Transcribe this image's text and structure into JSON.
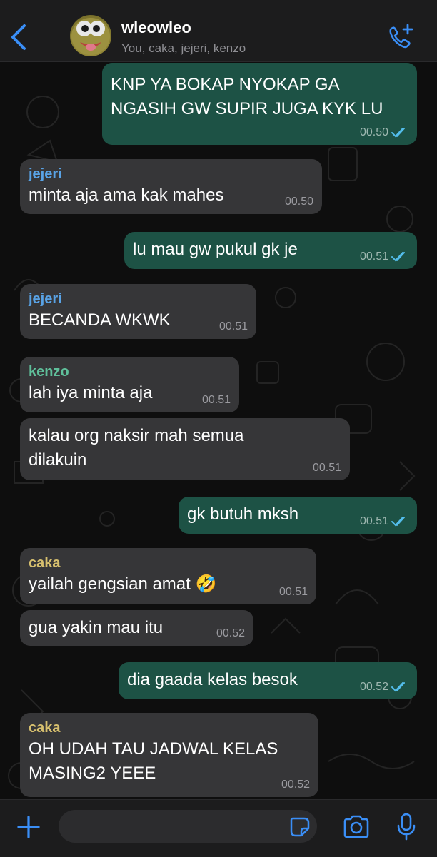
{
  "header": {
    "title": "wleowleo",
    "subtitle": "You, caka, jejeri, kenzo",
    "back_icon": "chevron-left-icon",
    "call_icon": "add-call-icon",
    "accent_color": "#3a8ef6"
  },
  "messages": [
    {
      "direction": "outgoing",
      "text": "KNP YA BOKAP NYOKAP GA\nNGASIH GW SUPIR JUGA KYK LU",
      "time": "00.50",
      "status": "read"
    },
    {
      "direction": "incoming",
      "sender": "jejeri",
      "sender_color": "#59a3e6",
      "text": "minta aja ama kak mahes",
      "time": "00.50"
    },
    {
      "direction": "outgoing",
      "text": "lu mau gw pukul gk je",
      "time": "00.51",
      "status": "read"
    },
    {
      "direction": "incoming",
      "sender": "jejeri",
      "sender_color": "#59a3e6",
      "text": "BECANDA WKWK",
      "time": "00.51"
    },
    {
      "direction": "incoming",
      "sender": "kenzo",
      "sender_color": "#5fbf9a",
      "text": "lah iya minta aja",
      "time": "00.51"
    },
    {
      "direction": "incoming",
      "text": "kalau org naksir mah semua\ndilakuin",
      "time": "00.51"
    },
    {
      "direction": "outgoing",
      "text": "gk butuh mksh",
      "time": "00.51",
      "status": "read"
    },
    {
      "direction": "incoming",
      "sender": "caka",
      "sender_color": "#d6bf6e",
      "text": "yailah gengsian amat 🤣",
      "time": "00.51"
    },
    {
      "direction": "incoming",
      "text": "gua yakin mau itu",
      "time": "00.52"
    },
    {
      "direction": "outgoing",
      "text": "dia gaada kelas besok",
      "time": "00.52",
      "status": "read"
    },
    {
      "direction": "incoming",
      "sender": "caka",
      "sender_color": "#d6bf6e",
      "text": "OH UDAH TAU JADWAL KELAS\nMASING2 YEEE",
      "time": "00.52"
    }
  ],
  "composer": {
    "placeholder": "",
    "plus_icon": "plus-icon",
    "sticker_icon": "sticker-icon",
    "camera_icon": "camera-icon",
    "mic_icon": "microphone-icon"
  },
  "colors": {
    "incoming_bubble": "#363638",
    "outgoing_bubble": "#1d5245",
    "read_ticks": "#53bdeb"
  }
}
